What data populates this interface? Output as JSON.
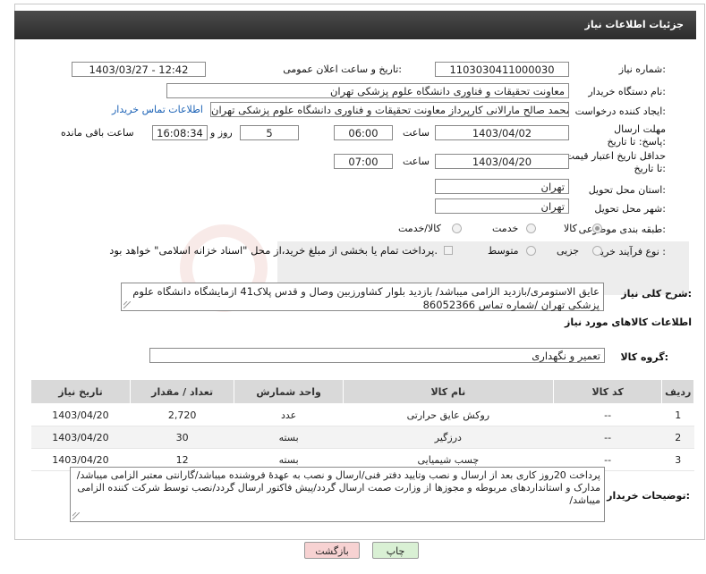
{
  "header": {
    "title": "جزئیات اطلاعات نیاز"
  },
  "fields": {
    "need_number_label": "شماره نیاز:",
    "need_number": "1103030411000030",
    "announce_label": "تاریخ و ساعت اعلان عمومی:",
    "announce_value": "1403/03/27 - 12:42",
    "buyer_org_label": "نام دستگاه خریدار:",
    "buyer_org": "معاونت تحقیقات و فناوری دانشگاه علوم پزشکی تهران",
    "requester_label": "ایجاد کننده درخواست:",
    "requester": "محمد صالح مارالانی کارپرداز معاونت تحقیقات و فناوری دانشگاه علوم پزشکی تهران",
    "buyer_contact_link": "اطلاعات تماس خریدار",
    "deadline_label": "مهلت ارسال پاسخ: تا تاریخ:",
    "deadline_date": "1403/04/02",
    "time_label": "ساعت",
    "deadline_time": "06:00",
    "days_value": "5",
    "days_label": "روز و",
    "remaining_time": "16:08:34",
    "remaining_label": "ساعت باقی مانده",
    "price_valid_label": "حداقل تاریخ اعتبار قیمت: تا تاریخ:",
    "price_valid_date": "1403/04/20",
    "price_valid_time": "07:00",
    "province_label": "استان محل تحویل:",
    "province": "تهران",
    "city_label": "شهر محل تحویل:",
    "city": "تهران",
    "category_label": "طبقه بندی موضوعی:",
    "category_options": [
      "کالا",
      "خدمت",
      "کالا/خدمت"
    ],
    "purchase_type_label": "نوع فرآیند خرید :",
    "purchase_options": [
      "جزیی",
      "متوسط"
    ],
    "purchase_note": "پرداخت تمام یا بخشی از مبلغ خرید،از محل \"اسناد خزانه اسلامی\" خواهد بود."
  },
  "description": {
    "label": "شرح کلی نیاز:",
    "text": "عایق الاستومری/بازدید الزامی میباشد/ بازدید بلوار کشاورزبین وصال و قدس پلاک41 ازمایشگاه دانشگاه علوم پزشکی تهران /شماره تماس 86052366"
  },
  "goods_info": {
    "title": "اطلاعات کالاهای مورد نیاز",
    "group_label": "گروه کالا:",
    "group_value": "تعمیر و نگهداری"
  },
  "table": {
    "headers": [
      "ردیف",
      "کد کالا",
      "نام کالا",
      "واحد شمارش",
      "تعداد / مقدار",
      "تاریخ نیاز"
    ],
    "rows": [
      {
        "row": "1",
        "code": "--",
        "name": "روکش عایق حرارتی",
        "unit": "عدد",
        "qty": "2,720",
        "date": "1403/04/20"
      },
      {
        "row": "2",
        "code": "--",
        "name": "درزگیر",
        "unit": "بسته",
        "qty": "30",
        "date": "1403/04/20"
      },
      {
        "row": "3",
        "code": "--",
        "name": "چسب شیمیایی",
        "unit": "بسته",
        "qty": "12",
        "date": "1403/04/20"
      }
    ]
  },
  "buyer_notes": {
    "label": "توضیحات خریدار:",
    "text": "پرداخت 20روز کاری بعد از ارسال و نصب  وتایید دفتر فنی/ارسال و نصب به عهدۀ فروشنده میباشد/گارانتی معتبر الزامی میباشد/مدارک و استانداردهای مربوطه و مجوزها از وزارت صمت ارسال گردد/پیش فاکتور ارسال گردد/نصب توسط شرکت کننده الزامی میباشد/"
  },
  "buttons": {
    "print": "چاپ",
    "back": "بازگشت"
  },
  "colors": {
    "header_bg": "#3a3a3a",
    "link": "#1b62b6",
    "back_btn": "#f7d2d2",
    "print_btn": "#d9f0d4"
  }
}
